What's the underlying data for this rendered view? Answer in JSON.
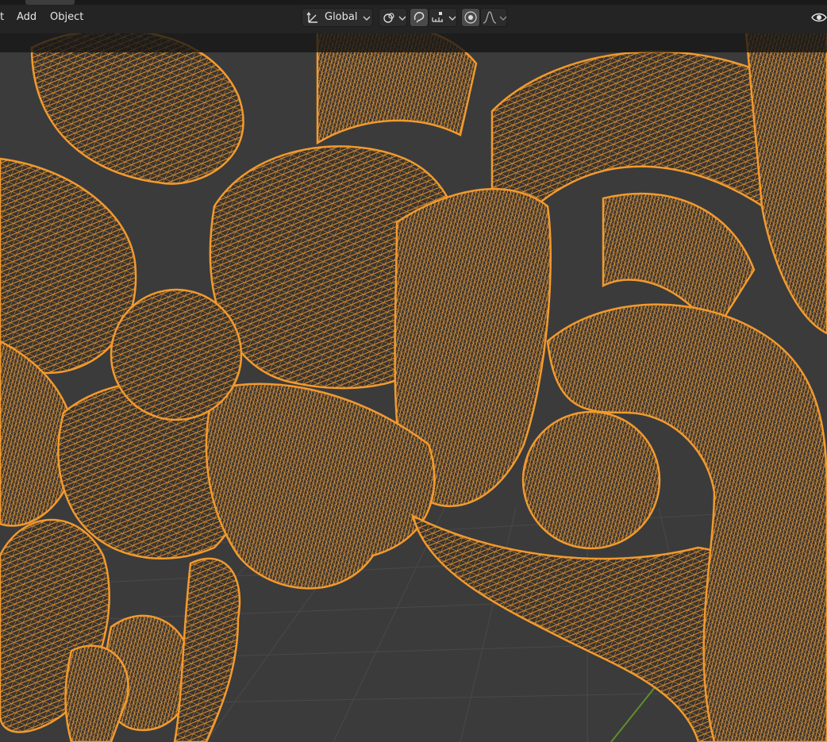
{
  "header": {
    "menu": [
      {
        "label": "t"
      },
      {
        "label": "Add"
      },
      {
        "label": "Object"
      }
    ],
    "transform_orientation": {
      "value": "Global"
    },
    "icons": {
      "orientation": "transform-orientation-icon",
      "pivot": "pivot-point-icon",
      "snap": "snap-icon",
      "snap_increment": "snap-increment-icon",
      "proportional": "proportional-editing-icon",
      "falloff": "falloff-curve-icon",
      "visibility": "eye-icon"
    }
  },
  "viewport": {
    "wire_color": "#f29a2e",
    "background_color": "#3b3b3b",
    "grid_color": "#4a4a4a"
  }
}
